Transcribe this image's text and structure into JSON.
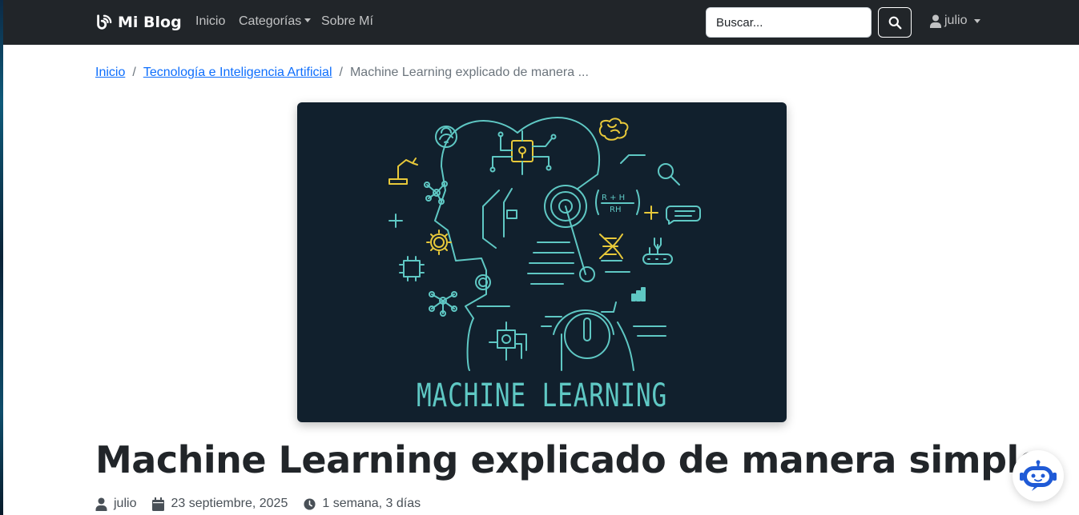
{
  "navbar": {
    "brand": "Mi Blog",
    "brand_icon": "blog-rss-icon",
    "links": {
      "inicio": "Inicio",
      "categorias": "Categorías",
      "sobre_mi": "Sobre Mí"
    },
    "search": {
      "placeholder": "Buscar...",
      "value": "",
      "button_icon": "search-icon"
    },
    "user": {
      "name": "julio",
      "icon": "user-icon"
    },
    "bg_color": "#212529"
  },
  "breadcrumb": {
    "items": [
      "Inicio",
      "Tecnología e Inteligencia Artificial"
    ],
    "current": "Machine Learning explicado de manera ..."
  },
  "hero": {
    "caption": "MACHINE LEARNING",
    "illustration": "ai-head-circuit-illustration",
    "bg_color": "#11202d",
    "line_color": "#5fc8c4",
    "accent_color": "#e8c93a"
  },
  "post": {
    "title": "Machine Learning explicado de manera simple",
    "author": "julio",
    "date": "23 septiembre, 2025",
    "reading_time": "1 semana, 3 días"
  },
  "chat_widget": {
    "icon": "robot-chat-icon",
    "color": "#1f5ad6"
  },
  "colors": {
    "link": "#0d6efd",
    "muted": "#6c757d"
  }
}
